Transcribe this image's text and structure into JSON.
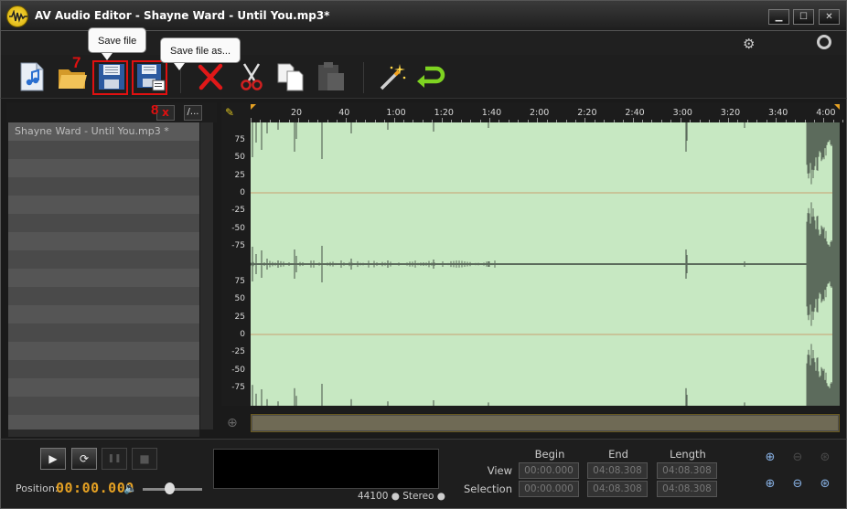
{
  "window": {
    "title": "AV Audio Editor - Shayne Ward - Until You.mp3*",
    "minimize": "▁",
    "maximize": "☐",
    "close": "✕"
  },
  "toolbar": {
    "buttons": [
      {
        "name": "new-file-button",
        "icon": "music-file-icon"
      },
      {
        "name": "open-file-button",
        "icon": "folder-icon"
      },
      {
        "name": "save-file-button",
        "icon": "floppy-icon"
      },
      {
        "name": "save-file-as-button",
        "icon": "floppy-as-icon"
      },
      {
        "name": "delete-button",
        "icon": "red-x-icon"
      },
      {
        "name": "cut-button",
        "icon": "scissors-icon"
      },
      {
        "name": "copy-button",
        "icon": "copy-icon"
      },
      {
        "name": "paste-button",
        "icon": "paste-icon"
      },
      {
        "name": "effects-button",
        "icon": "magic-wand-icon"
      },
      {
        "name": "undo-button",
        "icon": "undo-arrow-icon"
      }
    ]
  },
  "annotations": {
    "step7": "7",
    "step8": "8",
    "tooltip_save": "Save file",
    "tooltip_save_as": "Save file as..."
  },
  "file_list": {
    "items": [
      "Shayne Ward -  Until You.mp3 *"
    ],
    "close_btn": "x",
    "menu_btn": "/..."
  },
  "ruler": {
    "labels": [
      "20",
      "40",
      "1:00",
      "1:20",
      "1:40",
      "2:00",
      "2:20",
      "2:40",
      "3:00",
      "3:20",
      "3:40",
      "4:00"
    ]
  },
  "amplitude_labels": {
    "top": [
      "75",
      "50",
      "25",
      "0",
      "-25",
      "-50",
      "-75"
    ],
    "bottom": [
      "75",
      "50",
      "25",
      "0",
      "-25",
      "-50",
      "-75"
    ]
  },
  "transport": {
    "play": "▶",
    "loop": "⟳",
    "pause": "❚❚",
    "stop": "■",
    "position_label": "Position:",
    "position_value": "00:00.000",
    "volume_level": 0.45
  },
  "format": {
    "text": "44100 ● Stereo ●"
  },
  "selection": {
    "headers": [
      "Begin",
      "End",
      "Length"
    ],
    "view_label": "View",
    "selection_label": "Selection",
    "view": [
      "00:00.000",
      "04:08.308",
      "04:08.308"
    ],
    "selection": [
      "00:00.000",
      "04:08.308",
      "04:08.308"
    ]
  },
  "colors": {
    "waveform_bg": "#c7e8c2",
    "waveform": "#5c6b5c",
    "accent_orange": "#e5a123",
    "annotation_red": "#e01010"
  }
}
